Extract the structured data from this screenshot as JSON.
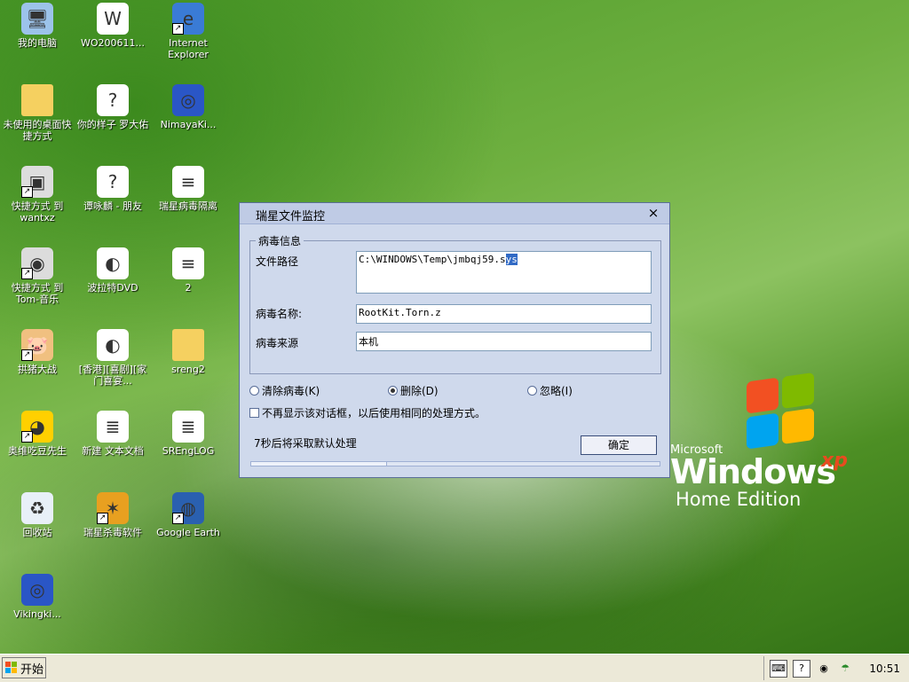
{
  "desktop_icons": [
    {
      "label": "我的电脑",
      "icon": "my-computer-icon",
      "shortcut": false
    },
    {
      "label": "WO200611...",
      "icon": "word-document-icon",
      "shortcut": false
    },
    {
      "label": "Internet Explorer",
      "icon": "internet-explorer-icon",
      "shortcut": true
    },
    {
      "label": "未使用的桌面快捷方式",
      "icon": "folder-icon",
      "shortcut": false
    },
    {
      "label": "你的样子 罗大佑",
      "icon": "realplayer-file-icon",
      "shortcut": false
    },
    {
      "label": "NimayaKi...",
      "icon": "blue-app-icon",
      "shortcut": false
    },
    {
      "label": "快捷方式 到 wantxz",
      "icon": "network-computer-icon",
      "shortcut": true
    },
    {
      "label": "谭咏麟 - 朋友",
      "icon": "realplayer-file-icon",
      "shortcut": false
    },
    {
      "label": "瑞星病毒隔离",
      "icon": "rising-file-icon",
      "shortcut": false
    },
    {
      "label": "快捷方式 到 Tom-音乐",
      "icon": "cd-icon",
      "shortcut": true
    },
    {
      "label": "波拉特DVD",
      "icon": "media-file-icon",
      "shortcut": false
    },
    {
      "label": "2",
      "icon": "rising-file-icon",
      "shortcut": false
    },
    {
      "label": "拱猪大战",
      "icon": "pig-game-icon",
      "shortcut": true
    },
    {
      "label": "[香港][喜剧][家门喜宴...",
      "icon": "media-file-icon",
      "shortcut": false
    },
    {
      "label": "sreng2",
      "icon": "folder-icon",
      "shortcut": false
    },
    {
      "label": "奥维吃豆先生",
      "icon": "pacman-icon",
      "shortcut": true
    },
    {
      "label": "新建 文本文档",
      "icon": "text-document-icon",
      "shortcut": false
    },
    {
      "label": "SREngLOG",
      "icon": "text-document-icon",
      "shortcut": false
    },
    {
      "label": "回收站",
      "icon": "recycle-bin-icon",
      "shortcut": false
    },
    {
      "label": "瑞星杀毒软件",
      "icon": "rising-antivirus-icon",
      "shortcut": true
    },
    {
      "label": "Google Earth",
      "icon": "google-earth-icon",
      "shortcut": true
    },
    {
      "label": "Vikingki...",
      "icon": "blue-app-icon",
      "shortcut": false
    }
  ],
  "dialog": {
    "title": "瑞星文件监控",
    "close": "×",
    "group_title": "病毒信息",
    "file_path_label": "文件路径",
    "file_path_value_a": "C:\\WINDOWS\\Temp\\jmbqj59.s",
    "file_path_value_sel": "ys",
    "virus_name_label": "病毒名称:",
    "virus_name_value": "RootKit.Torn.z",
    "virus_source_label": "病毒来源",
    "virus_source_value": "本机",
    "options": [
      {
        "label": "清除病毒(K)",
        "selected": false
      },
      {
        "label": "删除(D)",
        "selected": true
      },
      {
        "label": "忽略(I)",
        "selected": false
      }
    ],
    "checkbox_label": "不再显示该对话框，以后使用相同的处理方式。",
    "checkbox_checked": false,
    "countdown": "7秒后将采取默认处理",
    "ok_label": "确定",
    "progress": 0.33
  },
  "logo": {
    "microsoft": "Microsoft",
    "windows": "Windows",
    "xp": "xp",
    "edition": "Home Edition"
  },
  "taskbar": {
    "start_label": "开始",
    "clock": "10:51"
  }
}
